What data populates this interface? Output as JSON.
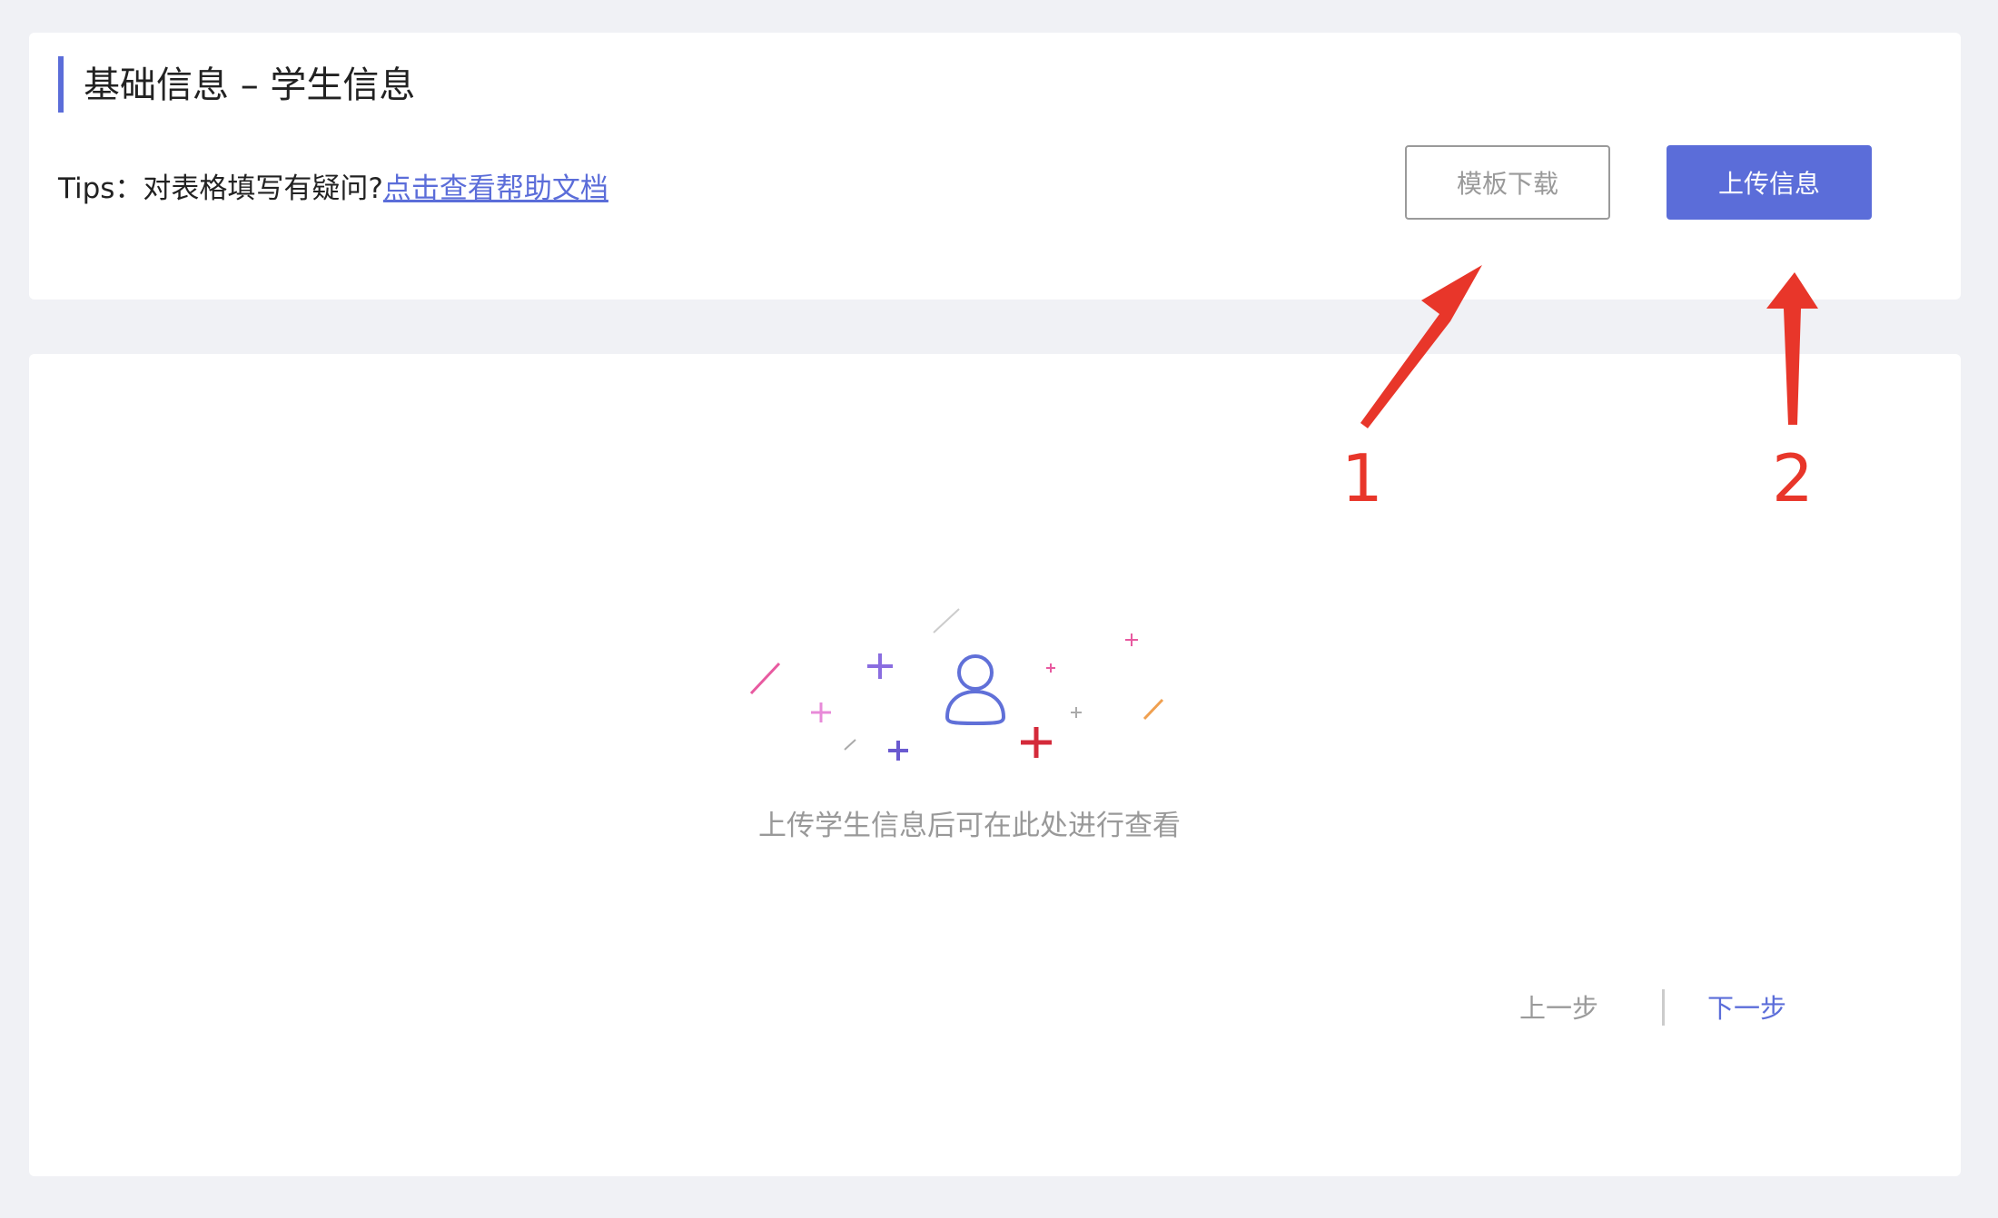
{
  "header": {
    "title": "基础信息 – 学生信息",
    "tips_prefix": "Tips：对表格填写有疑问?",
    "help_link": "点击查看帮助文档"
  },
  "actions": {
    "template_download": "模板下载",
    "upload_info": "上传信息"
  },
  "empty_state": {
    "icon": "user-icon",
    "message": "上传学生信息后可在此处进行查看"
  },
  "footer_nav": {
    "prev": "上一步",
    "next": "下一步"
  },
  "annotations": {
    "marker_1": "1",
    "marker_2": "2"
  },
  "colors": {
    "accent": "#5b6dd9",
    "annotation": "#e8362a",
    "background": "#f0f1f5"
  }
}
